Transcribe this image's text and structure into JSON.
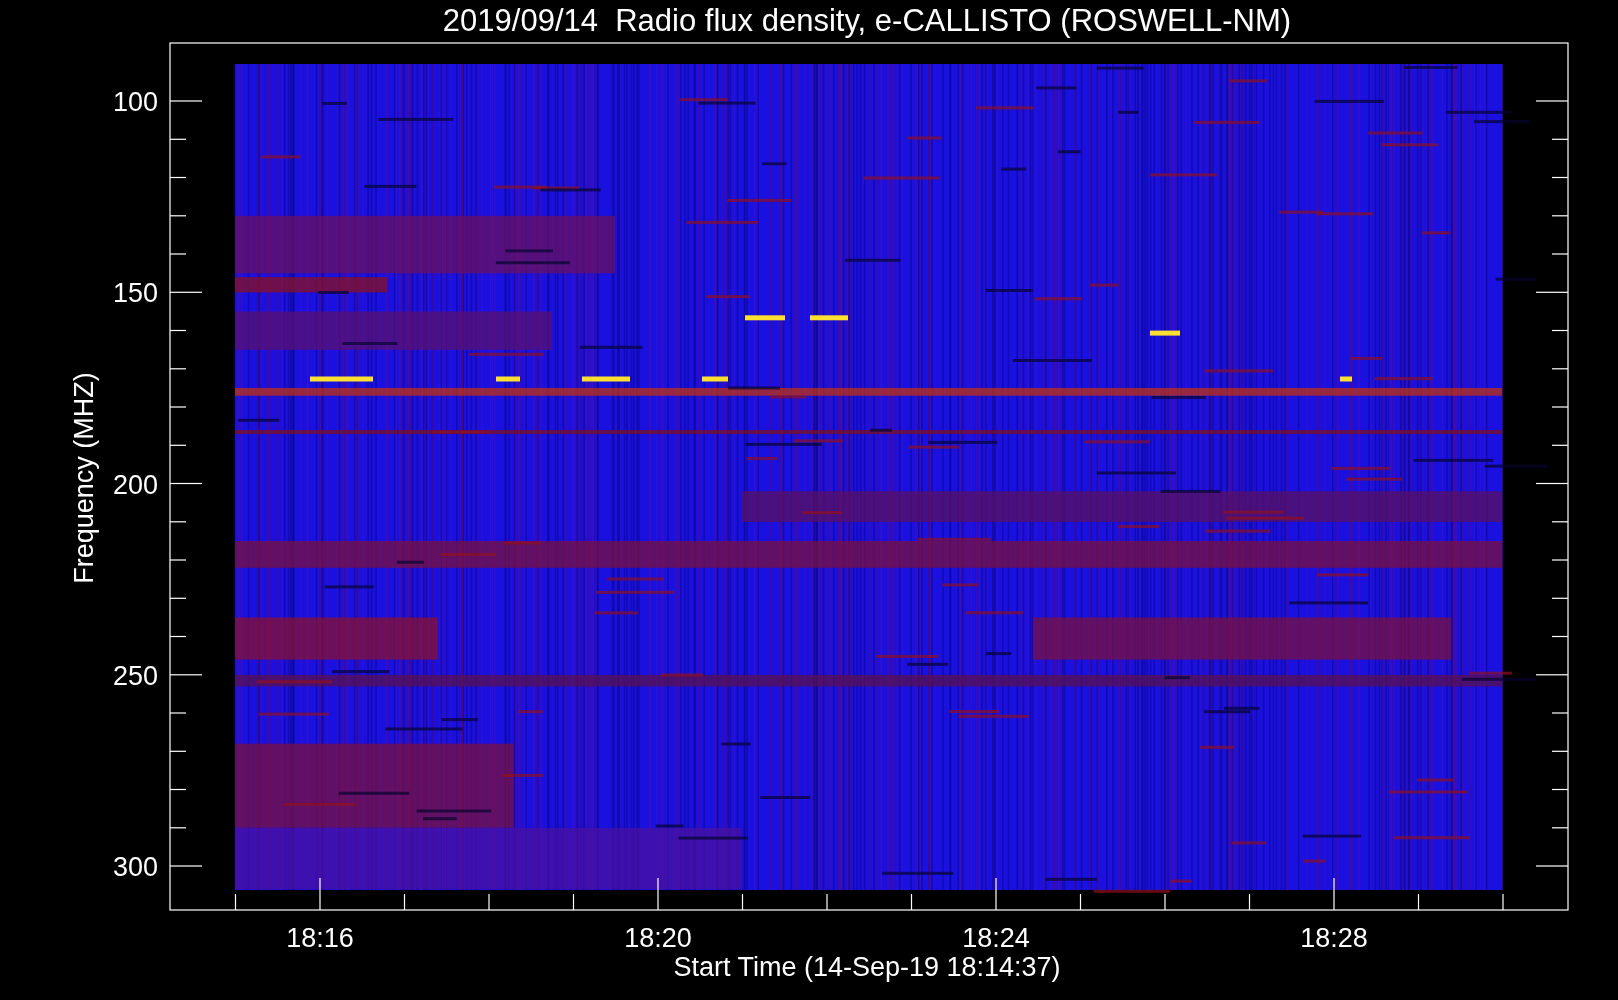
{
  "title": "2019/09/14  Radio flux density, e-CALLISTO (ROSWELL-NM)",
  "y_axis": {
    "label": "Frequency (MHZ)",
    "ticks": [
      "100",
      "150",
      "200",
      "250",
      "300"
    ]
  },
  "x_axis": {
    "label": "Start Time (14-Sep-19 18:14:37)",
    "ticks": [
      "18:16",
      "18:20",
      "18:24",
      "18:28"
    ]
  }
}
